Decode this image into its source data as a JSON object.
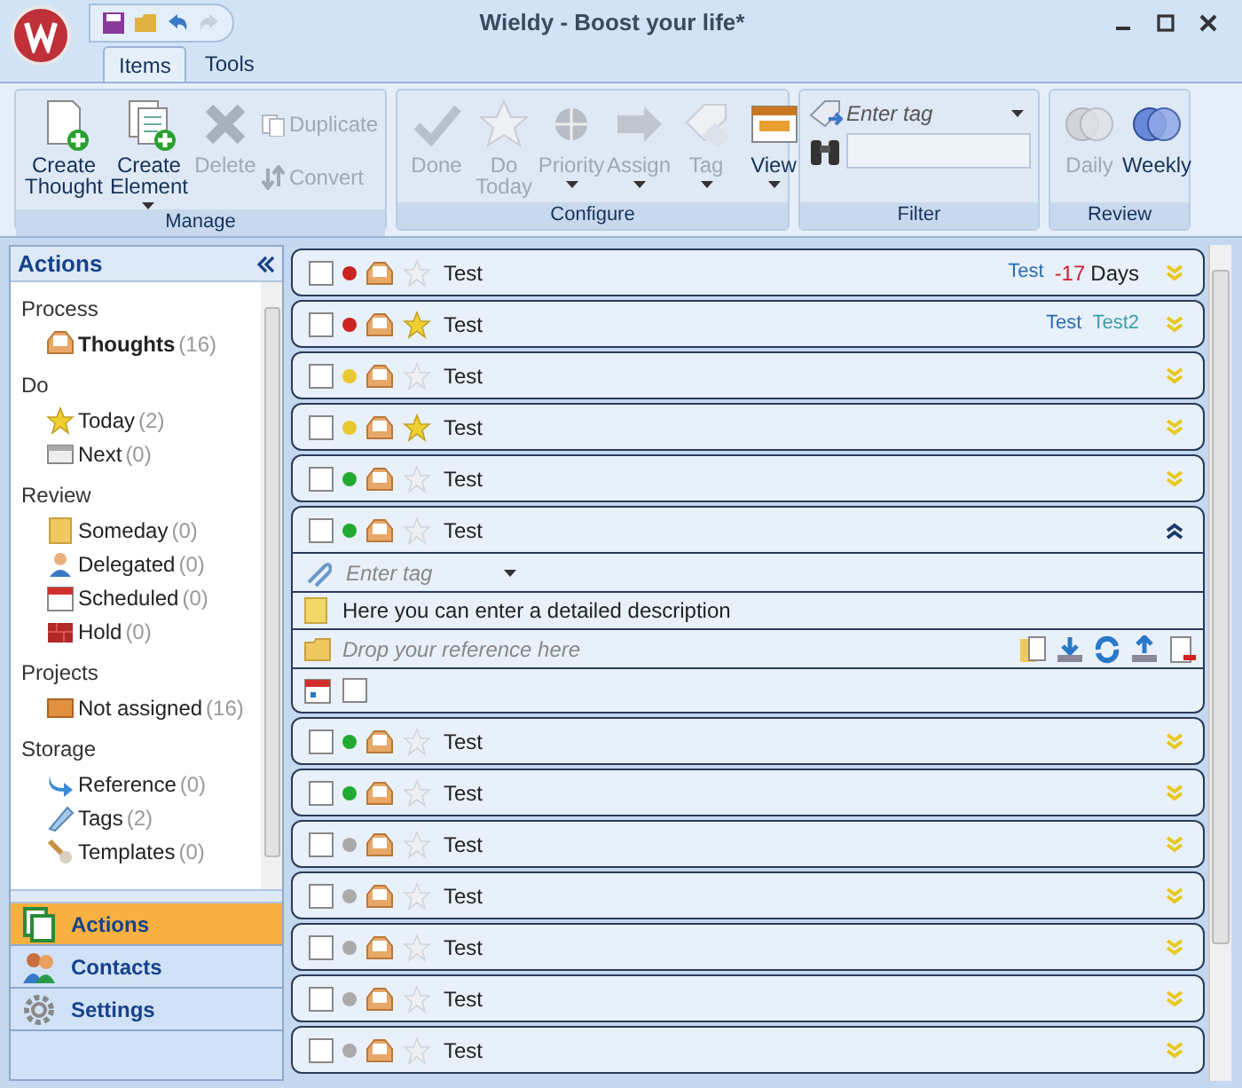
{
  "window": {
    "title": "Wieldy - Boost your life*"
  },
  "tabs": [
    {
      "label": "Items",
      "selected": true
    },
    {
      "label": "Tools",
      "selected": false
    }
  ],
  "ribbon": [
    {
      "title": "Manage",
      "buttons": [
        {
          "label": "Create Thought",
          "kind": "large",
          "disabled": false
        },
        {
          "label": "Create Element",
          "kind": "large",
          "disabled": false,
          "dropdown": true
        },
        {
          "label": "Delete",
          "kind": "large",
          "disabled": true
        },
        {
          "label": "Duplicate",
          "kind": "small",
          "disabled": true
        },
        {
          "label": "Convert",
          "kind": "small",
          "disabled": true
        }
      ]
    },
    {
      "title": "Configure",
      "buttons": [
        {
          "label": "Done",
          "kind": "large",
          "disabled": true
        },
        {
          "label": "Do Today",
          "kind": "large",
          "disabled": true
        },
        {
          "label": "Priority",
          "kind": "large",
          "disabled": true,
          "dropdown": true
        },
        {
          "label": "Assign",
          "kind": "large",
          "disabled": true,
          "dropdown": true
        },
        {
          "label": "Tag",
          "kind": "large",
          "disabled": true,
          "dropdown": true
        },
        {
          "label": "View",
          "kind": "large",
          "disabled": false,
          "dropdown": true
        }
      ]
    },
    {
      "title": "Filter",
      "tag_field": {
        "placeholder": "Enter tag"
      }
    },
    {
      "title": "Review",
      "buttons": [
        {
          "label": "Daily",
          "kind": "large",
          "disabled": true
        },
        {
          "label": "Weekly",
          "kind": "large",
          "disabled": false
        }
      ]
    }
  ],
  "sidebar": {
    "title": "Actions",
    "sections": [
      {
        "title": "Process",
        "items": [
          {
            "label": "Thoughts",
            "count": "(16)",
            "selected": true
          }
        ]
      },
      {
        "title": "Do",
        "items": [
          {
            "label": "Today",
            "count": "(2)",
            "selected": false
          },
          {
            "label": "Next",
            "count": "(0)",
            "selected": false
          }
        ]
      },
      {
        "title": "Review",
        "items": [
          {
            "label": "Someday",
            "count": "(0)",
            "selected": false
          },
          {
            "label": "Delegated",
            "count": "(0)",
            "selected": false
          },
          {
            "label": "Scheduled",
            "count": "(0)",
            "selected": false
          },
          {
            "label": "Hold",
            "count": "(0)",
            "selected": false
          }
        ]
      },
      {
        "title": "Projects",
        "items": [
          {
            "label": "Not assigned",
            "count": "(16)",
            "selected": false
          }
        ]
      },
      {
        "title": "Storage",
        "items": [
          {
            "label": "Reference",
            "count": "(0)",
            "selected": false
          },
          {
            "label": "Tags",
            "count": "(2)",
            "selected": false
          },
          {
            "label": "Templates",
            "count": "(0)",
            "selected": false
          }
        ]
      }
    ],
    "nav": [
      {
        "label": "Actions",
        "selected": true
      },
      {
        "label": "Contacts",
        "selected": false
      },
      {
        "label": "Settings",
        "selected": false
      }
    ]
  },
  "tasks": [
    {
      "title": "Test",
      "checked": false,
      "color": "#cc2222",
      "starred": false,
      "expanded": false,
      "tags": [
        {
          "label": "Test",
          "color": "#2a6db0"
        }
      ],
      "due": {
        "value": "-17",
        "unit": "Days"
      }
    },
    {
      "title": "Test",
      "checked": false,
      "color": "#cc2222",
      "starred": true,
      "expanded": false,
      "tags": [
        {
          "label": "Test",
          "color": "#2a6db0"
        },
        {
          "label": "Test2",
          "color": "#3a9fa8"
        }
      ]
    },
    {
      "title": "Test",
      "checked": false,
      "color": "#e8c830",
      "starred": false,
      "expanded": false
    },
    {
      "title": "Test",
      "checked": false,
      "color": "#e8c830",
      "starred": true,
      "expanded": false
    },
    {
      "title": "Test",
      "checked": false,
      "color": "#22aa33",
      "starred": false,
      "expanded": false
    },
    {
      "title": "Test",
      "checked": false,
      "color": "#22aa33",
      "starred": false,
      "expanded": true,
      "detail": {
        "tag_placeholder": "Enter tag",
        "description": "Here you can enter a detailed description",
        "reference_placeholder": "Drop your reference here",
        "reminder_checked": false
      }
    },
    {
      "title": "Test",
      "checked": false,
      "color": "#22aa33",
      "starred": false,
      "expanded": false
    },
    {
      "title": "Test",
      "checked": false,
      "color": "#22aa33",
      "starred": false,
      "expanded": false
    },
    {
      "title": "Test",
      "checked": false,
      "color": "#aaaaaa",
      "starred": false,
      "expanded": false
    },
    {
      "title": "Test",
      "checked": false,
      "color": "#aaaaaa",
      "starred": false,
      "expanded": false
    },
    {
      "title": "Test",
      "checked": false,
      "color": "#aaaaaa",
      "starred": false,
      "expanded": false
    },
    {
      "title": "Test",
      "checked": false,
      "color": "#aaaaaa",
      "starred": false,
      "expanded": false
    },
    {
      "title": "Test",
      "checked": false,
      "color": "#aaaaaa",
      "starred": false,
      "expanded": false
    }
  ]
}
